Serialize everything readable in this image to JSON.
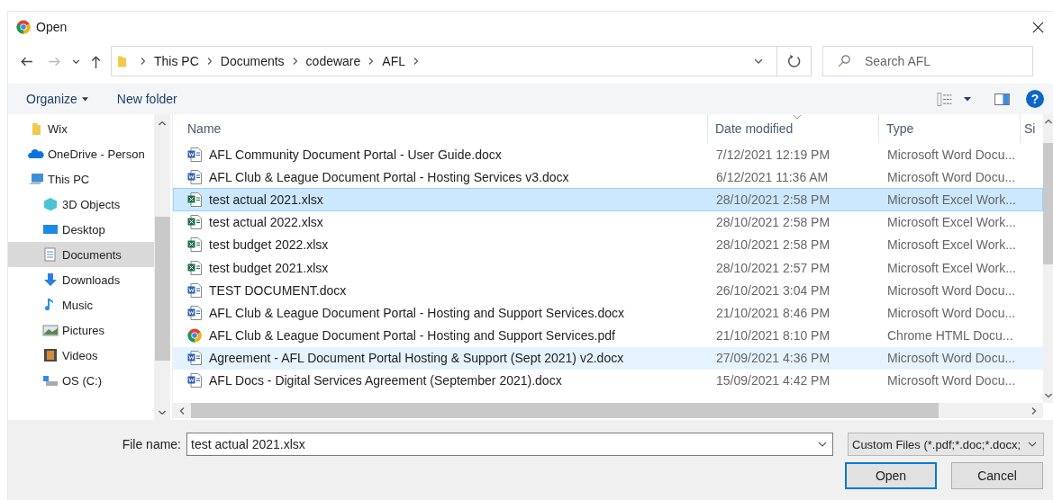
{
  "window": {
    "title": "Open"
  },
  "address": {
    "path": [
      "This PC",
      "Documents",
      "codeware",
      "AFL"
    ]
  },
  "search": {
    "placeholder": "Search AFL"
  },
  "toolbar": {
    "organize": "Organize",
    "new_folder": "New folder",
    "help": "?"
  },
  "sidebar": {
    "items": [
      {
        "label": "Wix",
        "kind": "folder",
        "selected": false
      },
      {
        "label": "OneDrive - Person",
        "kind": "cloud",
        "selected": false
      },
      {
        "label": "This PC",
        "kind": "pc",
        "selected": false,
        "children": [
          {
            "label": "3D Objects",
            "kind": "cube",
            "selected": false
          },
          {
            "label": "Desktop",
            "kind": "desktop",
            "selected": false
          },
          {
            "label": "Documents",
            "kind": "documents",
            "selected": true
          },
          {
            "label": "Downloads",
            "kind": "downloads",
            "selected": false
          },
          {
            "label": "Music",
            "kind": "music",
            "selected": false
          },
          {
            "label": "Pictures",
            "kind": "pictures",
            "selected": false
          },
          {
            "label": "Videos",
            "kind": "videos",
            "selected": false
          },
          {
            "label": "OS (C:)",
            "kind": "drive",
            "selected": false
          }
        ]
      }
    ]
  },
  "table": {
    "columns": [
      "Name",
      "Date modified",
      "Type",
      "Si"
    ],
    "rows": [
      {
        "name": "AFL Community Document Portal - User Guide.docx",
        "date": "7/12/2021 12:19 PM",
        "type": "Microsoft Word Docu...",
        "kind": "word",
        "selected": false,
        "hovered": false
      },
      {
        "name": "AFL Club & League Document Portal - Hosting Services v3.docx",
        "date": "6/12/2021 11:36 AM",
        "type": "Microsoft Word Docu...",
        "kind": "word",
        "selected": false,
        "hovered": false
      },
      {
        "name": "test actual 2021.xlsx",
        "date": "28/10/2021 2:58 PM",
        "type": "Microsoft Excel Work...",
        "kind": "excel",
        "selected": true,
        "hovered": false
      },
      {
        "name": "test actual 2022.xlsx",
        "date": "28/10/2021 2:58 PM",
        "type": "Microsoft Excel Work...",
        "kind": "excel",
        "selected": false,
        "hovered": false
      },
      {
        "name": "test budget 2022.xlsx",
        "date": "28/10/2021 2:58 PM",
        "type": "Microsoft Excel Work...",
        "kind": "excel",
        "selected": false,
        "hovered": false
      },
      {
        "name": "test budget 2021.xlsx",
        "date": "28/10/2021 2:57 PM",
        "type": "Microsoft Excel Work...",
        "kind": "excel",
        "selected": false,
        "hovered": false
      },
      {
        "name": "TEST DOCUMENT.docx",
        "date": "26/10/2021 3:04 PM",
        "type": "Microsoft Word Docu...",
        "kind": "word",
        "selected": false,
        "hovered": false
      },
      {
        "name": "AFL Club & League Document Portal - Hosting and Support Services.docx",
        "date": "21/10/2021 8:46 PM",
        "type": "Microsoft Word Docu...",
        "kind": "word",
        "selected": false,
        "hovered": false
      },
      {
        "name": "AFL Club & League Document Portal - Hosting and Support Services.pdf",
        "date": "21/10/2021 8:10 PM",
        "type": "Chrome HTML Docu...",
        "kind": "chrome",
        "selected": false,
        "hovered": false
      },
      {
        "name": "Agreement - AFL Document Portal Hosting & Support (Sept 2021) v2.docx",
        "date": "27/09/2021 4:36 PM",
        "type": "Microsoft Word Docu...",
        "kind": "word",
        "selected": false,
        "hovered": true
      },
      {
        "name": "AFL Docs - Digital Services Agreement (September 2021).docx",
        "date": "15/09/2021 4:42 PM",
        "type": "Microsoft Word Docu...",
        "kind": "word",
        "selected": false,
        "hovered": false
      }
    ]
  },
  "file_name": {
    "label": "File name:",
    "value": "test actual 2021.xlsx"
  },
  "file_type": {
    "value": "Custom Files (*.pdf;*.doc;*.docx;"
  },
  "buttons": [
    "Open",
    "Cancel"
  ]
}
